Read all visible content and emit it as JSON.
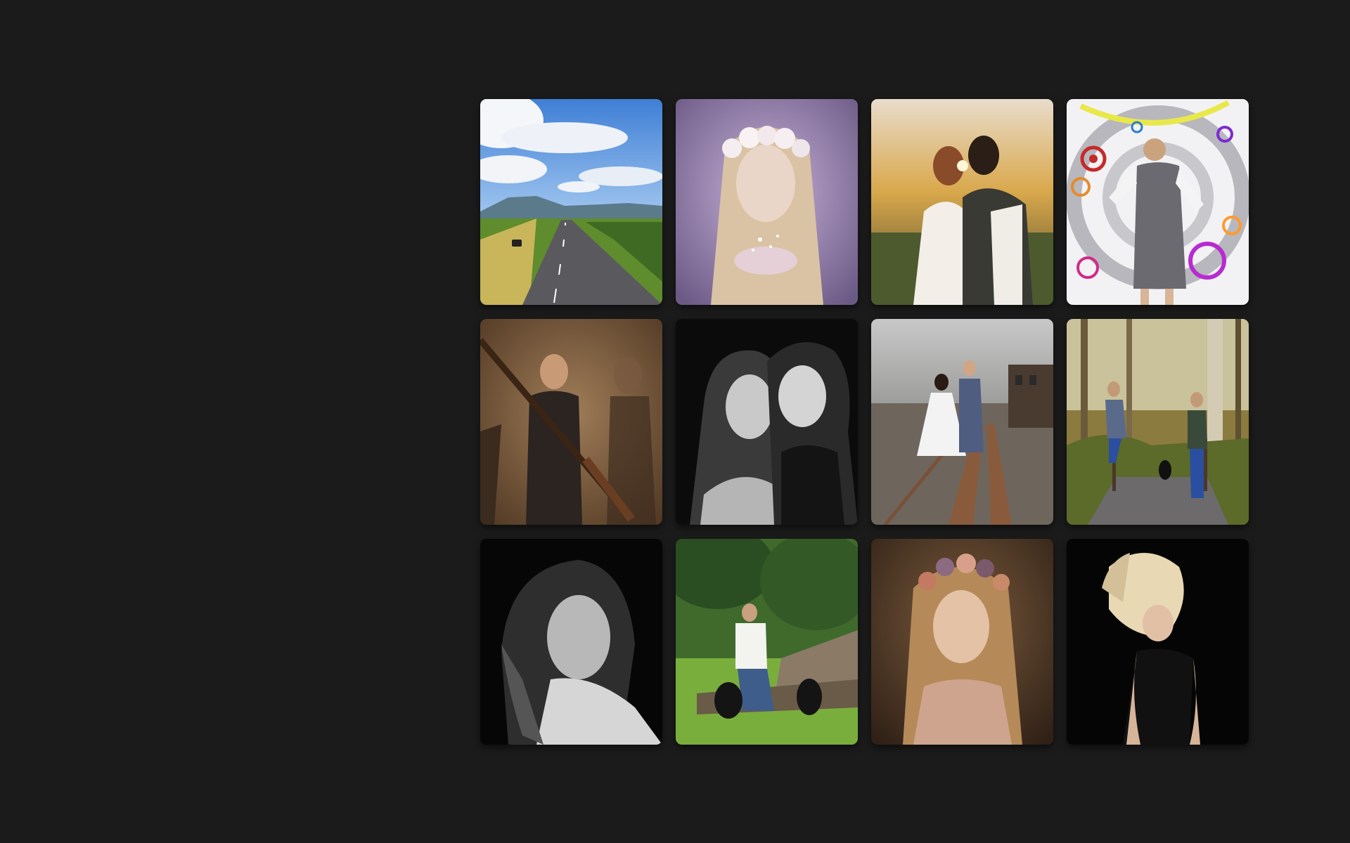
{
  "page": {
    "background": "#1b1b1b"
  },
  "gallery": {
    "items": [
      {
        "subject": "country-road-landscape"
      },
      {
        "subject": "girl-flower-crown-blowing-sparkles"
      },
      {
        "subject": "couple-sunset-embrace"
      },
      {
        "subject": "woman-pop-art-circles"
      },
      {
        "subject": "woman-with-shotgun-sepia"
      },
      {
        "subject": "two-girls-black-and-white"
      },
      {
        "subject": "wedding-couple-railway"
      },
      {
        "subject": "couple-woodland-bridge-dog"
      },
      {
        "subject": "woman-black-and-white-portrait"
      },
      {
        "subject": "man-with-two-dogs-log"
      },
      {
        "subject": "girl-flower-crown-portrait"
      },
      {
        "subject": "woman-hair-flip-black-background"
      }
    ]
  }
}
